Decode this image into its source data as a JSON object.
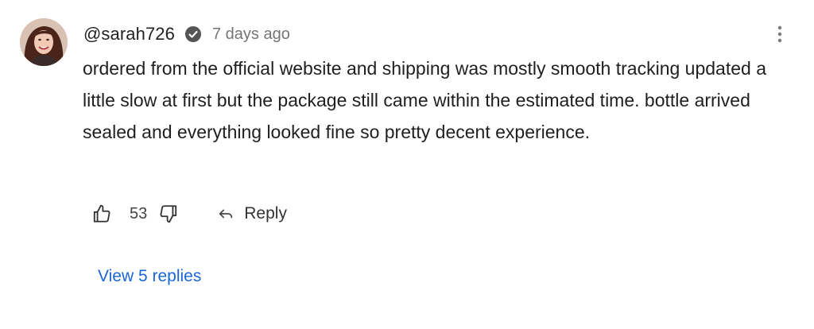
{
  "comment": {
    "username": "@sarah726",
    "timestamp": "7 days ago",
    "verified": true,
    "avatar_icon": "user-avatar-photo",
    "text": "ordered from the official website and shipping was mostly smooth tracking updated a little slow at first but the package still came within the estimated time. bottle arrived sealed and everything looked fine so pretty decent experience.",
    "like_count": "53",
    "reply_label": "Reply",
    "view_replies_label": "View 5 replies"
  },
  "icons": {
    "verified": "verified-check-icon",
    "more": "more-vertical-icon",
    "like": "thumbs-up-icon",
    "dislike": "thumbs-down-icon",
    "reply": "reply-arrow-icon"
  },
  "colors": {
    "text": "#1f1f1f",
    "muted": "#757575",
    "link": "#1a66d6",
    "verified_badge": "#555555"
  }
}
